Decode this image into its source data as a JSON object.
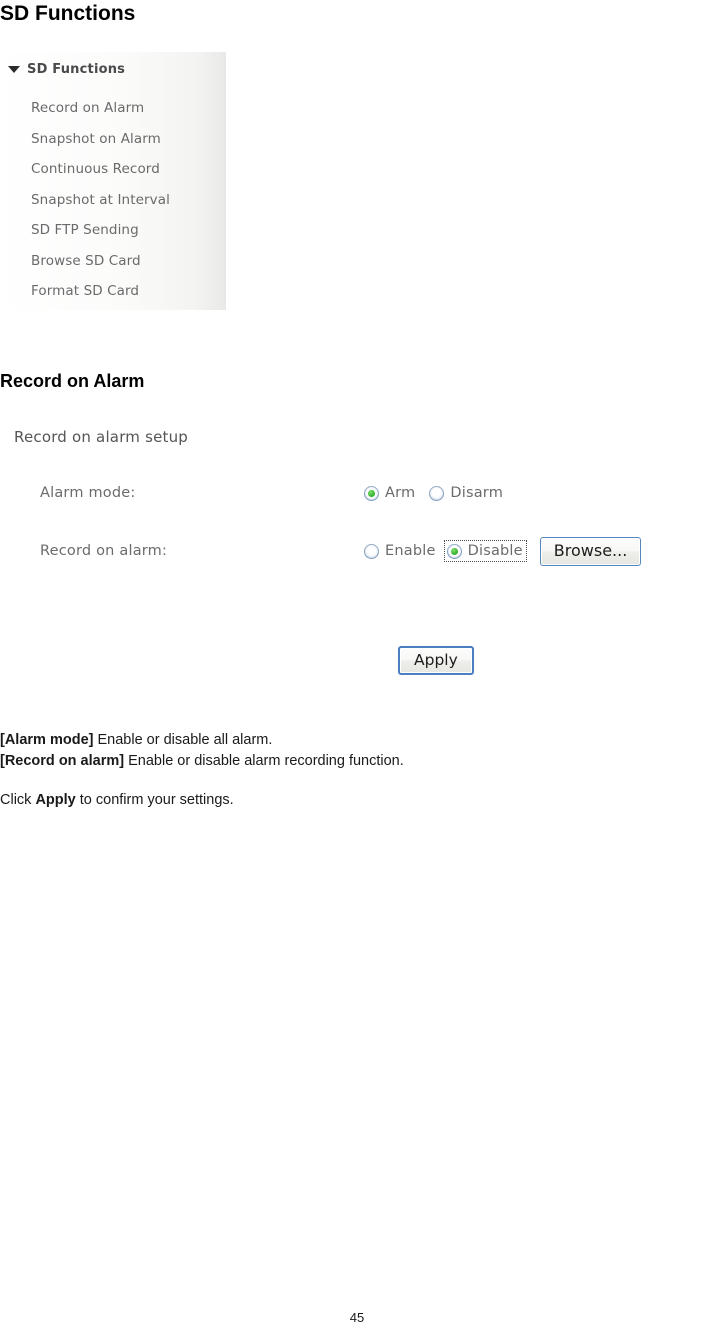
{
  "document": {
    "page_heading": "SD Functions",
    "page_number": "45"
  },
  "sidebar": {
    "expand_icon": "triangle-down-icon",
    "header_label": "SD Functions",
    "items": [
      {
        "label": "Record on Alarm"
      },
      {
        "label": "Snapshot on Alarm"
      },
      {
        "label": "Continuous Record"
      },
      {
        "label": "Snapshot at Interval"
      },
      {
        "label": "SD FTP Sending"
      },
      {
        "label": "Browse SD Card"
      },
      {
        "label": "Format SD Card"
      }
    ]
  },
  "section": {
    "heading": "Record on Alarm"
  },
  "form": {
    "title": "Record on alarm setup",
    "rows": [
      {
        "label": "Alarm mode:",
        "options": [
          {
            "label": "Arm",
            "selected": true,
            "focused": false
          },
          {
            "label": "Disarm",
            "selected": false,
            "focused": false
          }
        ]
      },
      {
        "label": "Record on alarm:",
        "options": [
          {
            "label": "Enable",
            "selected": false,
            "focused": false
          },
          {
            "label": "Disable",
            "selected": true,
            "focused": true
          }
        ],
        "browse_label": "Browse..."
      }
    ],
    "apply_label": "Apply"
  },
  "description": {
    "line1_term": "[Alarm mode]",
    "line1_text": " Enable or disable all alarm.",
    "line2_term": "[Record on alarm]",
    "line2_text": " Enable or disable alarm recording function.",
    "line3_prefix": "Click ",
    "line3_bold": "Apply",
    "line3_suffix": " to confirm your settings."
  },
  "colors": {
    "radio_selected_dot": "#36b32e",
    "radio_ring": "#5c7fa8",
    "button_border": "#5588bb",
    "apply_border": "#4a7fc1",
    "sidebar_text": "#6a6a6a"
  }
}
